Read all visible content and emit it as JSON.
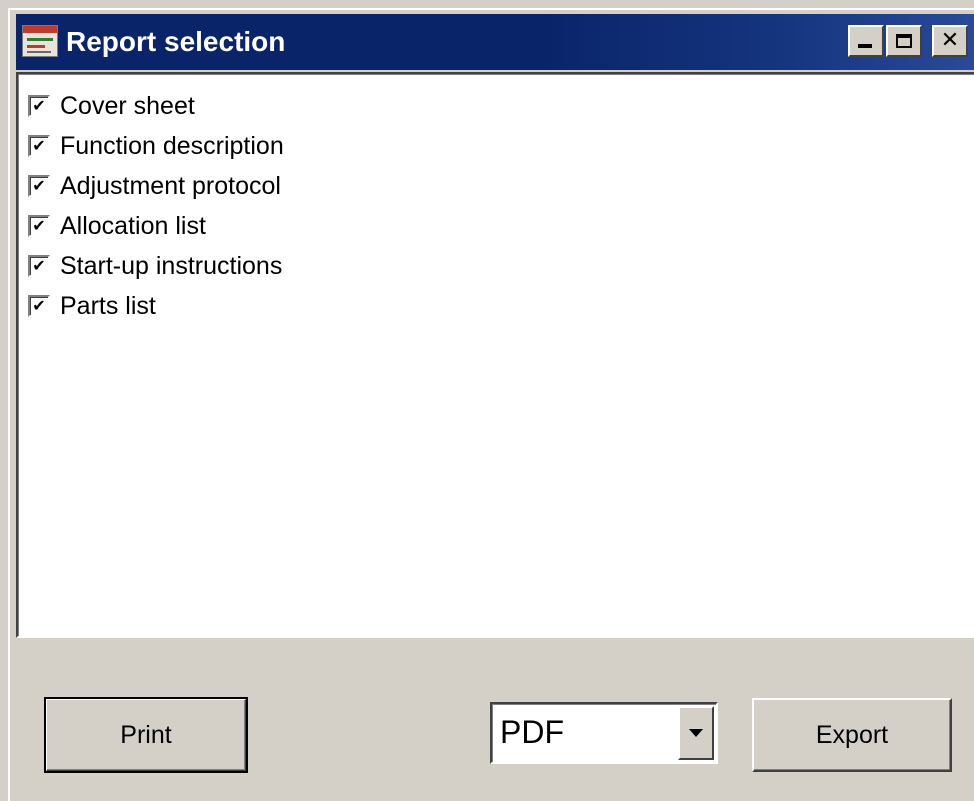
{
  "window": {
    "title": "Report selection",
    "icons": {
      "app": "app-document-icon",
      "minimize": "minimize-icon",
      "maximize": "maximize-icon",
      "close": "close-icon"
    },
    "close_glyph": "✕"
  },
  "report_list": {
    "items": [
      {
        "label": "Cover sheet",
        "checked": true
      },
      {
        "label": "Function description",
        "checked": true
      },
      {
        "label": "Adjustment protocol",
        "checked": true
      },
      {
        "label": "Allocation list",
        "checked": true
      },
      {
        "label": "Start-up instructions",
        "checked": true
      },
      {
        "label": "Parts list",
        "checked": true
      }
    ],
    "check_glyph": "✔"
  },
  "actions": {
    "print_label": "Print",
    "export_label": "Export",
    "format_select": {
      "selected": "PDF"
    }
  },
  "colors": {
    "titlebar": "#0a246a",
    "face": "#d4d0c8",
    "list_background": "#ffffff"
  }
}
